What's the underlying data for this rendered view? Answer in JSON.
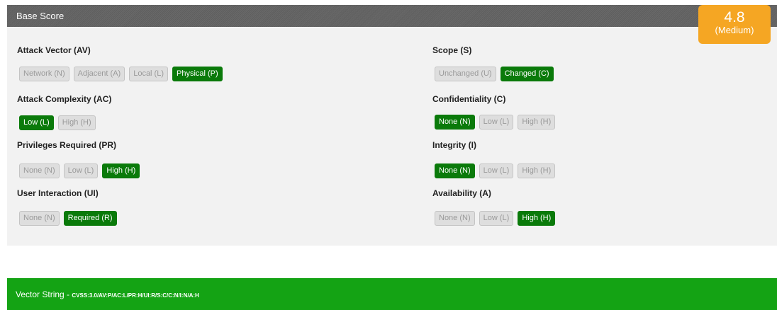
{
  "header": {
    "title": "Base Score"
  },
  "score": {
    "value": "4.8",
    "severity": "(Medium)"
  },
  "metrics": {
    "av": {
      "label": "Attack Vector (AV)",
      "options": [
        "Network (N)",
        "Adjacent (A)",
        "Local (L)",
        "Physical (P)"
      ],
      "selected": "Physical (P)"
    },
    "ac": {
      "label": "Attack Complexity (AC)",
      "options": [
        "Low (L)",
        "High (H)"
      ],
      "selected": "Low (L)"
    },
    "pr": {
      "label": "Privileges Required (PR)",
      "options": [
        "None (N)",
        "Low (L)",
        "High (H)"
      ],
      "selected": "High (H)"
    },
    "ui": {
      "label": "User Interaction (UI)",
      "options": [
        "None (N)",
        "Required (R)"
      ],
      "selected": "Required (R)"
    },
    "s": {
      "label": "Scope (S)",
      "options": [
        "Unchanged (U)",
        "Changed (C)"
      ],
      "selected": "Changed (C)"
    },
    "c": {
      "label": "Confidentiality (C)",
      "options": [
        "None (N)",
        "Low (L)",
        "High (H)"
      ],
      "selected": "None (N)"
    },
    "i": {
      "label": "Integrity (I)",
      "options": [
        "None (N)",
        "Low (L)",
        "High (H)"
      ],
      "selected": "None (N)"
    },
    "a": {
      "label": "Availability (A)",
      "options": [
        "None (N)",
        "Low (L)",
        "High (H)"
      ],
      "selected": "High (H)"
    }
  },
  "vector": {
    "label": "Vector String -",
    "value": "CVSS:3.0/AV:P/AC:L/PR:H/UI:R/S:C/C:N/I:N/A:H"
  },
  "colors": {
    "selected": "#0a7a0a",
    "badge": "#f5a623",
    "vector_bar": "#14a314",
    "header": "#636363"
  }
}
